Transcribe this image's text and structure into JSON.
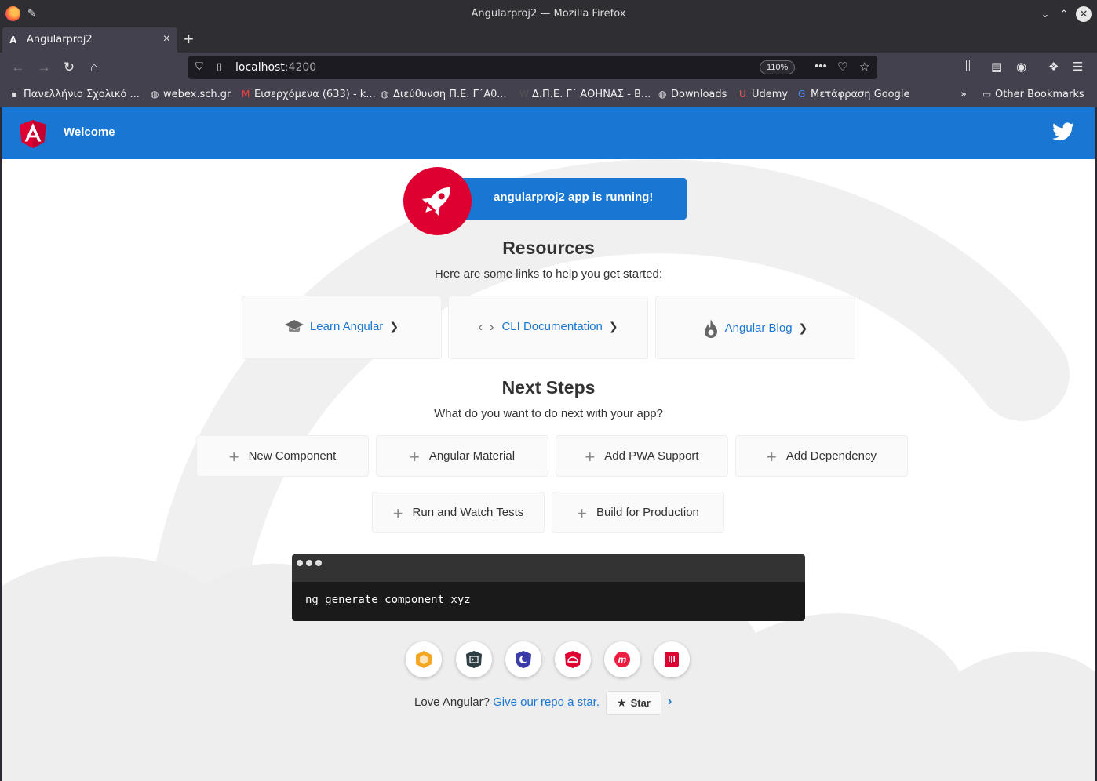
{
  "window": {
    "title": "Angularproj2 — Mozilla Firefox"
  },
  "tab": {
    "label": "Angularproj2",
    "favicon": "A"
  },
  "navbar": {
    "url_host": "localhost",
    "url_port": ":4200",
    "zoom": "110%"
  },
  "bookmarks": [
    {
      "label": "Πανελλήνιο Σχολικό ...",
      "icon": "sch-icon"
    },
    {
      "label": "webex.sch.gr",
      "icon": "globe-icon"
    },
    {
      "label": "Εισερχόμενα (633) - k...",
      "icon": "gmail-icon"
    },
    {
      "label": "Διεύθυνση Π.Ε. Γ΄Αθ...",
      "icon": "globe-icon"
    },
    {
      "label": "Δ.Π.Ε. Γ΄ ΑΘΗΝΑΣ - Β...",
      "icon": "wordpress-icon"
    },
    {
      "label": "Downloads",
      "icon": "globe-icon"
    },
    {
      "label": "Udemy",
      "icon": "udemy-icon"
    },
    {
      "label": "Μετάφραση Google",
      "icon": "translate-icon"
    }
  ],
  "other_bookmarks": "Other Bookmarks",
  "app": {
    "toolbar_title": "Welcome",
    "running_text": "angularproj2 app is running!",
    "resources_title": "Resources",
    "resources_sub": "Here are some links to help you get started:",
    "resources": [
      {
        "label": "Learn Angular",
        "icon": "graduation-cap-icon"
      },
      {
        "label": "CLI Documentation",
        "icon": "code-icon"
      },
      {
        "label": "Angular Blog",
        "icon": "flame-icon"
      }
    ],
    "next_title": "Next Steps",
    "next_sub": "What do you want to do next with your app?",
    "steps": [
      "New Component",
      "Angular Material",
      "Add PWA Support",
      "Add Dependency",
      "Run and Watch Tests",
      "Build for Production"
    ],
    "terminal_cmd": "ng generate component xyz",
    "links": [
      {
        "name": "animations-icon",
        "color": "#f5a623"
      },
      {
        "name": "cli-icon",
        "color": "#2f3d45"
      },
      {
        "name": "augury-icon",
        "color": "#3a3aa8"
      },
      {
        "name": "protractor-icon",
        "color": "#dd0031"
      },
      {
        "name": "meetup-icon",
        "color": "#ed1c40"
      },
      {
        "name": "discord-icon",
        "color": "#dd0031"
      }
    ],
    "love_text": "Love Angular?",
    "love_link": "Give our repo a star.",
    "star_label": "Star"
  }
}
